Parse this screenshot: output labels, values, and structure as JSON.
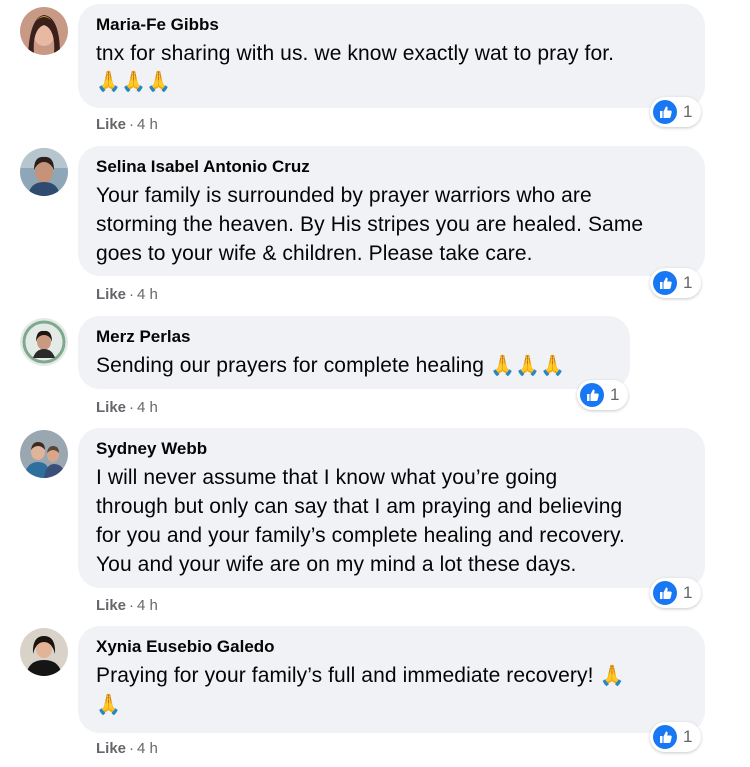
{
  "colors": {
    "bubble": "#f0f2f5",
    "meta": "#65676b",
    "like_blue": "#1877f2",
    "text": "#050505"
  },
  "comments": [
    {
      "author": "Maria-Fe Gibbs",
      "lines": [
        "tnx for sharing with us. we know exactly wat to pray for."
      ],
      "emoji_line": "🙏🙏🙏",
      "like_label": "Like",
      "time": "4 h",
      "reaction_icon": "like-icon",
      "reaction_count": "1"
    },
    {
      "author": "Selina Isabel Antonio Cruz",
      "lines": [
        "Your family is surrounded by prayer warriors who are",
        "storming the heaven. By His stripes you are healed. Same",
        "goes to your wife & children. Please take care."
      ],
      "like_label": "Like",
      "time": "4 h",
      "reaction_icon": "like-icon",
      "reaction_count": "1"
    },
    {
      "author": "Merz Perlas",
      "lines": [
        "Sending our prayers for complete healing"
      ],
      "emoji_inline": "🙏🙏🙏",
      "like_label": "Like",
      "time": "4 h",
      "reaction_icon": "like-icon",
      "reaction_count": "1"
    },
    {
      "author": "Sydney Webb",
      "lines": [
        "I will never assume that I know what you’re going",
        "through but only can say that I am praying and believing",
        "for you and your family’s complete healing and recovery.",
        "You and your wife are on my mind a lot these days."
      ],
      "like_label": "Like",
      "time": "4 h",
      "reaction_icon": "like-icon",
      "reaction_count": "1"
    },
    {
      "author": "Xynia Eusebio Galedo",
      "lines": [
        "Praying for your family’s full and immediate recovery!"
      ],
      "emoji_inline": "🙏",
      "emoji_line": "🙏",
      "like_label": "Like",
      "time": "4 h",
      "reaction_icon": "like-icon",
      "reaction_count": "1"
    }
  ]
}
